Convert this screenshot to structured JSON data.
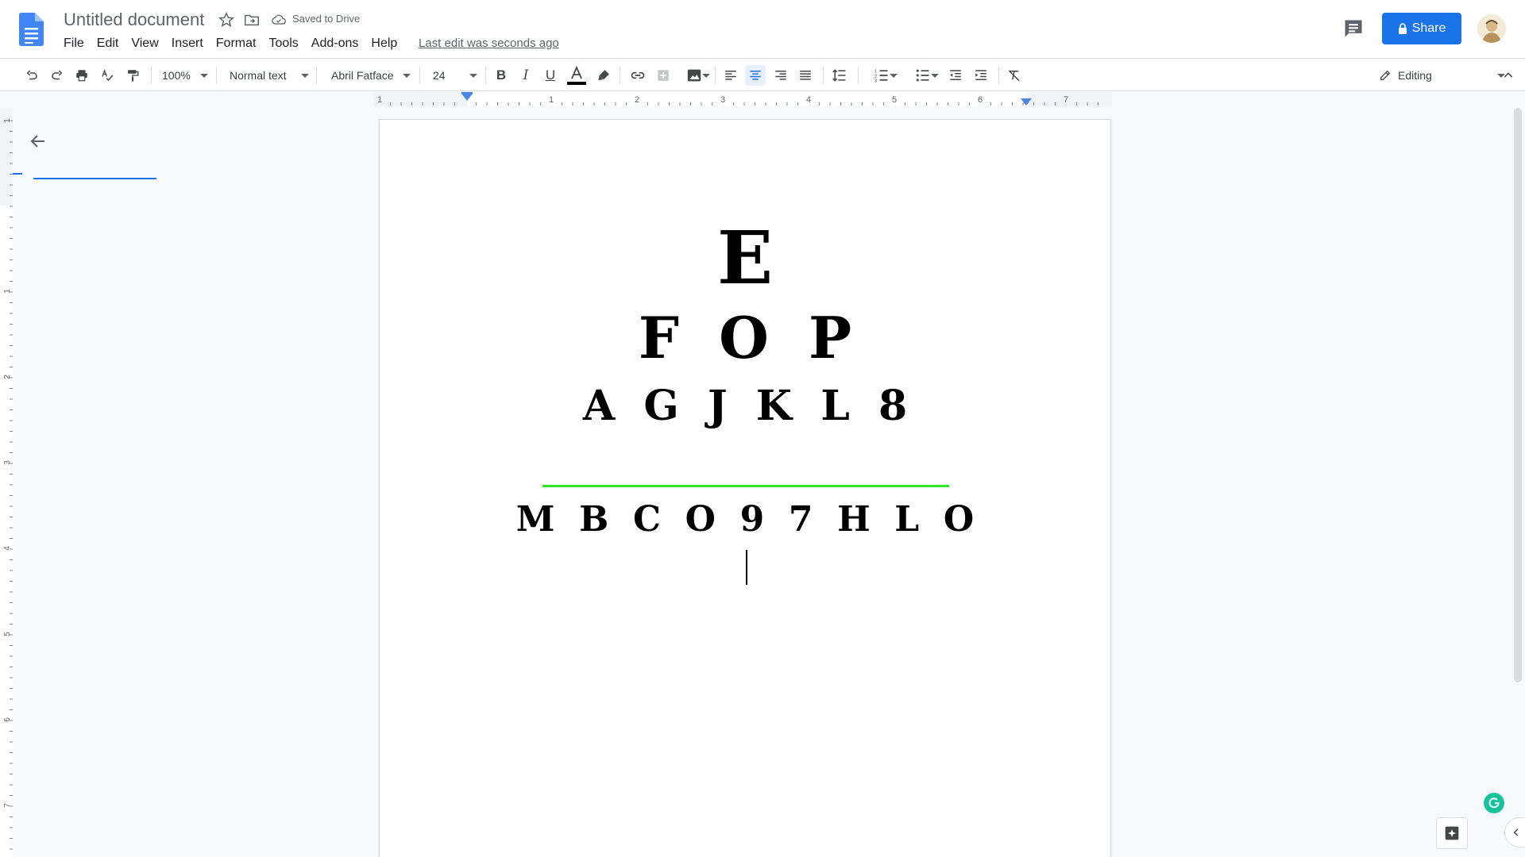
{
  "header": {
    "title": "Untitled document",
    "save_status": "Saved to Drive",
    "last_edit": "Last edit was seconds ago",
    "share_label": "Share",
    "menu": [
      "File",
      "Edit",
      "View",
      "Insert",
      "Format",
      "Tools",
      "Add-ons",
      "Help"
    ]
  },
  "toolbar": {
    "zoom": "100%",
    "style": "Normal text",
    "font": "Abril Fatface",
    "font_size": "24",
    "mode": "Editing",
    "text_color": "#000000",
    "active_alignment": "center"
  },
  "ruler": {
    "labels": [
      "1",
      "1",
      "2",
      "3",
      "4",
      "5",
      "6",
      "7"
    ],
    "vlabels": [
      "1",
      "1",
      "2",
      "3",
      "4",
      "5",
      "6",
      "7"
    ]
  },
  "document": {
    "lines": [
      "E",
      "F  O  P",
      "A  G  J  K  L  8",
      "M  B  C  O  9  7  H  L  O"
    ],
    "rule_color": "#2ee62a"
  },
  "colors": {
    "accent": "#1a73e8",
    "brand_docs": "#4285f4"
  }
}
